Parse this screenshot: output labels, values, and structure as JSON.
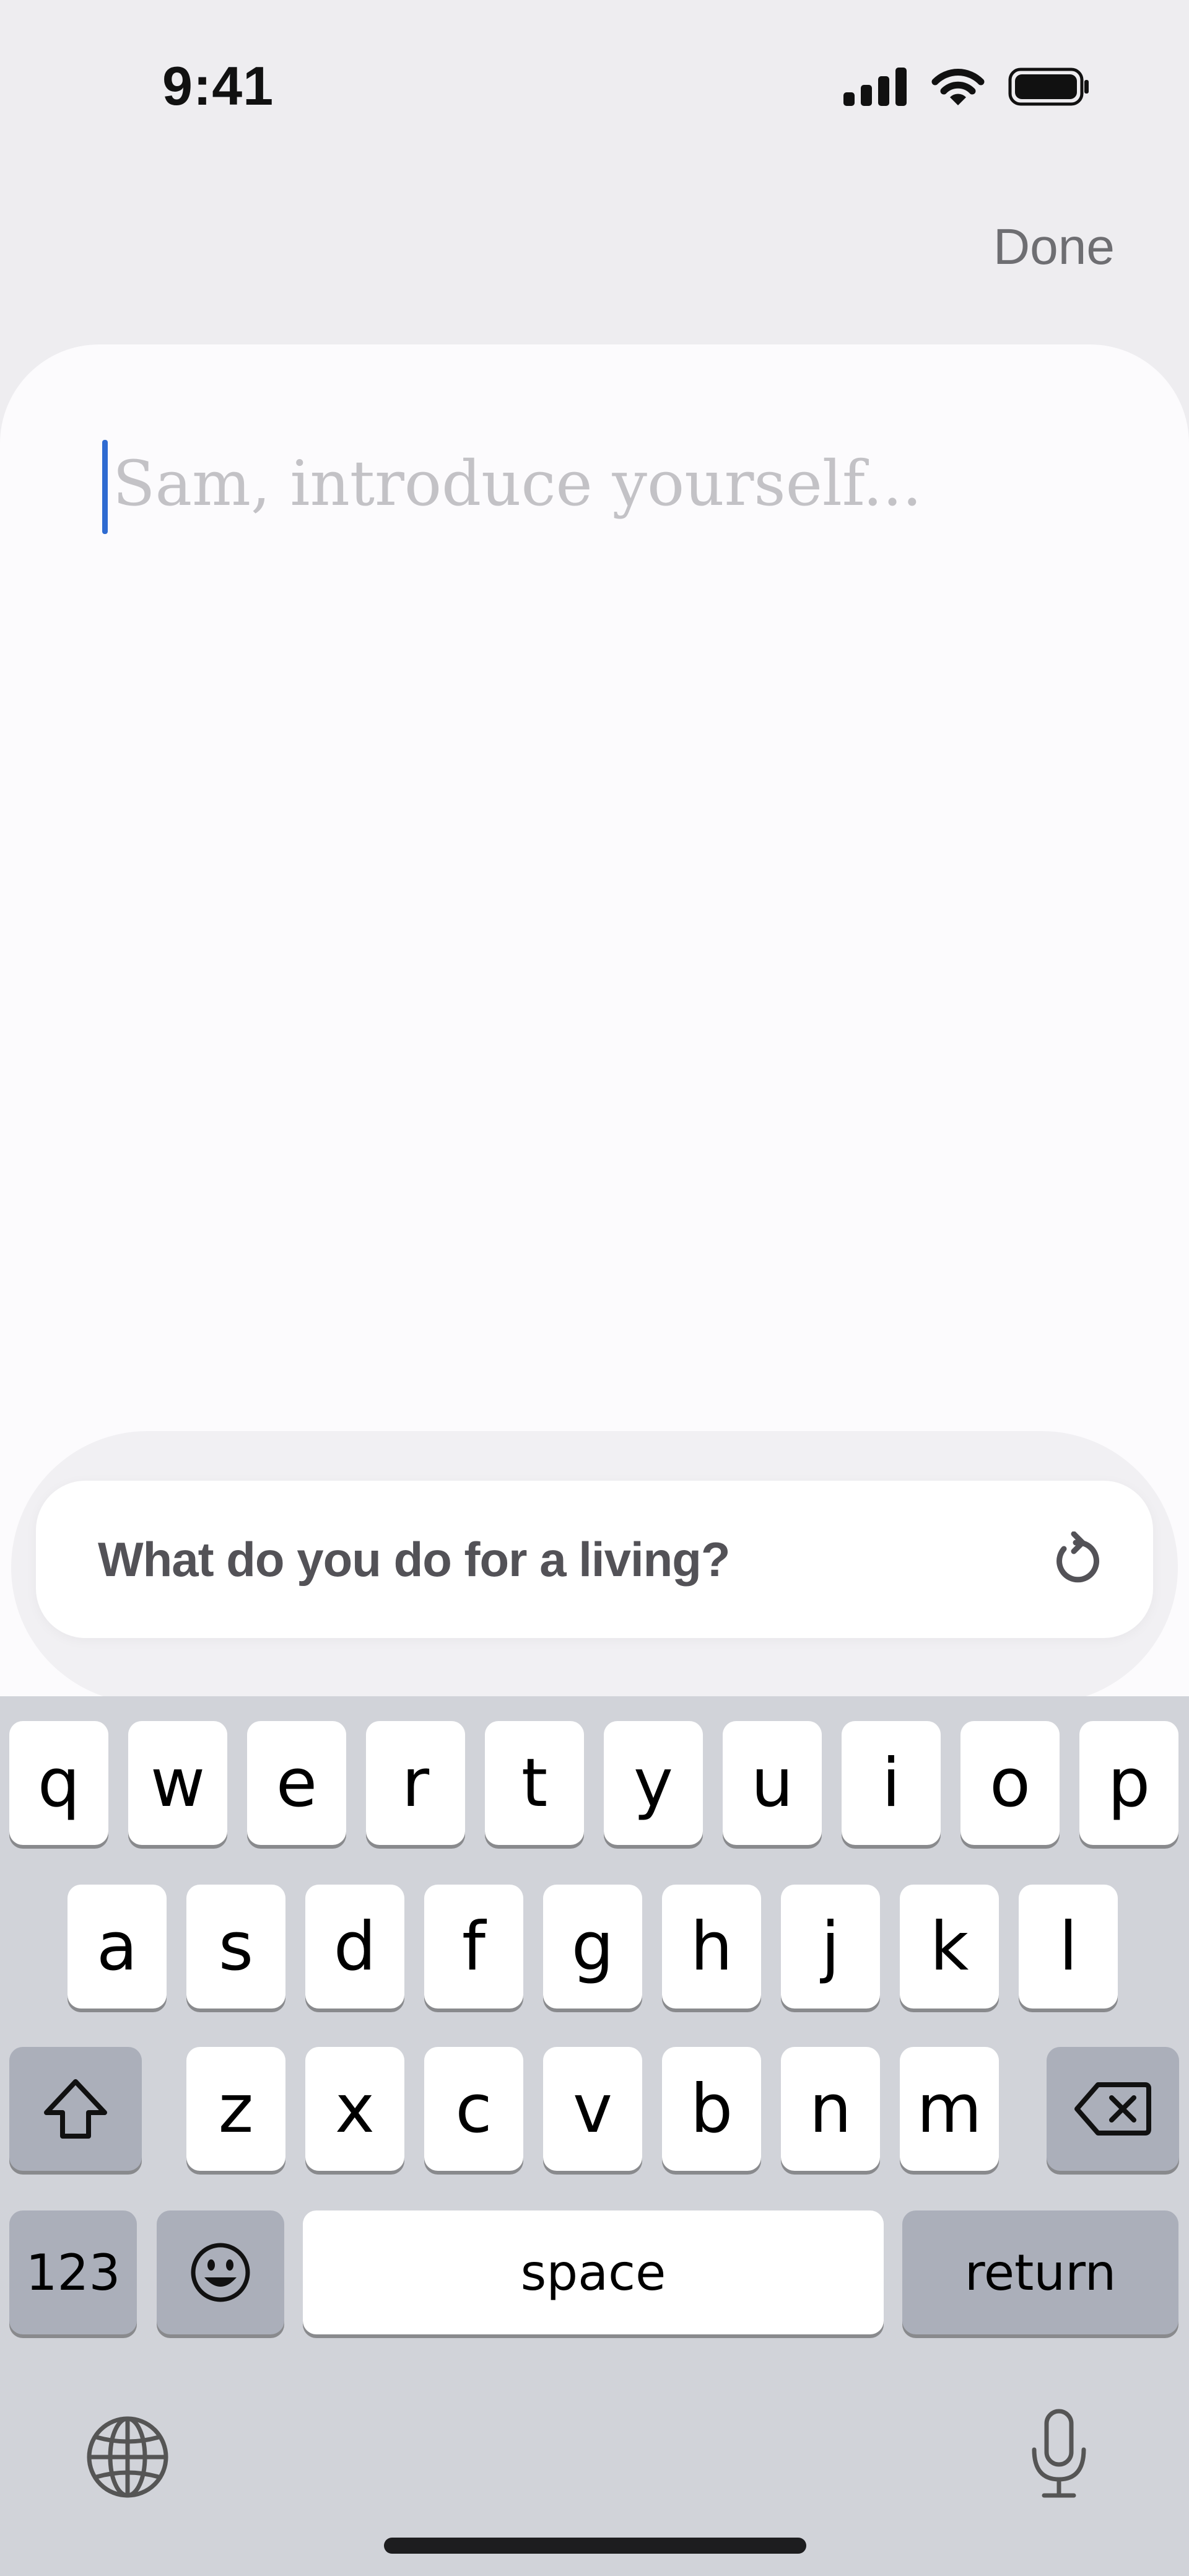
{
  "status_bar": {
    "time": "9:41",
    "icons": [
      "cellular-signal-icon",
      "wifi-icon",
      "battery-icon"
    ]
  },
  "header": {
    "done_label": "Done"
  },
  "composer": {
    "placeholder": "Sam, introduce yourself...",
    "caret_color": "#2f6bd1"
  },
  "suggestion": {
    "text": "What do you do for a living?",
    "icon": "refresh-icon"
  },
  "keyboard": {
    "row1": [
      "q",
      "w",
      "e",
      "r",
      "t",
      "y",
      "u",
      "i",
      "o",
      "p"
    ],
    "row2": [
      "a",
      "s",
      "d",
      "f",
      "g",
      "h",
      "j",
      "k",
      "l"
    ],
    "row3": [
      "z",
      "x",
      "c",
      "v",
      "b",
      "n",
      "m"
    ],
    "numbers_label": "123",
    "space_label": "space",
    "return_label": "return",
    "icons": [
      "shift-icon",
      "delete-icon",
      "emoji-icon",
      "globe-icon",
      "microphone-icon"
    ]
  }
}
